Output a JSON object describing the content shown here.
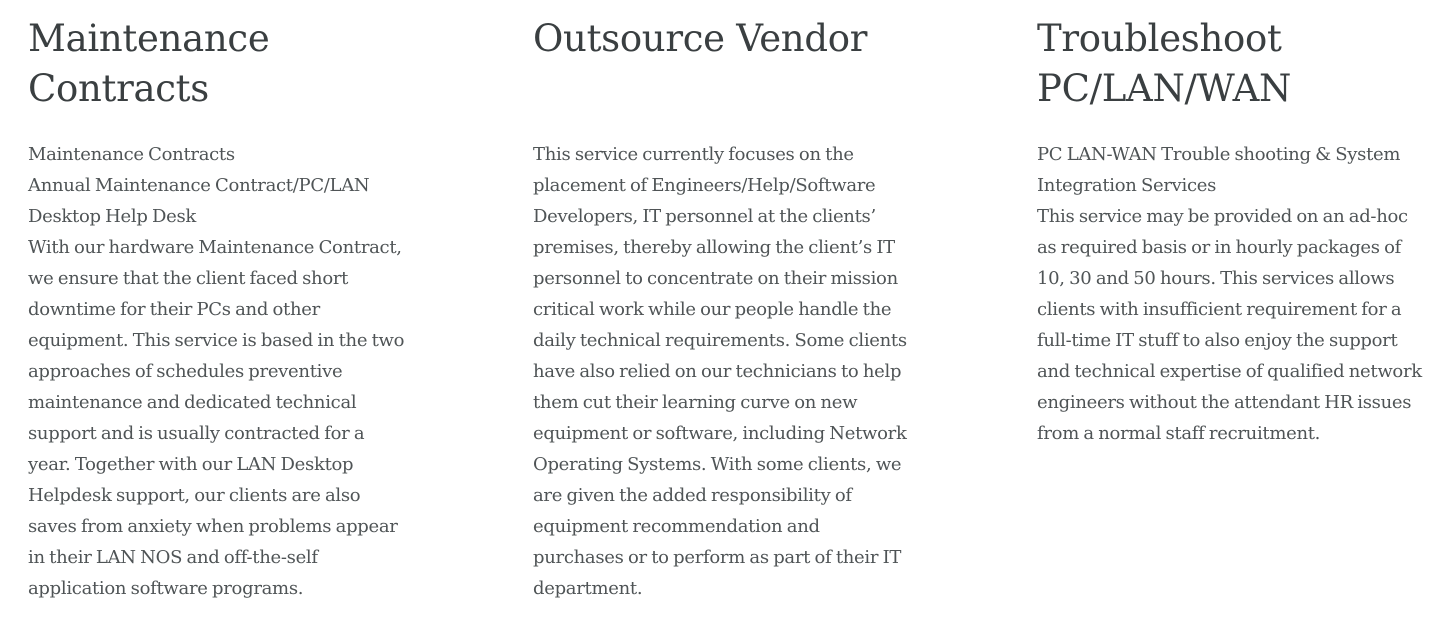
{
  "services": [
    {
      "title": "Maintenance Contracts",
      "paragraphs": [
        "Maintenance Contracts",
        "Annual Maintenance Contract/PC/LAN Desktop Help Desk",
        "With our hardware Maintenance Contract, we ensure that the client faced short downtime for their PCs and other equipment. This service is based in the two approaches of schedules preventive maintenance and dedicated technical support and is usually contracted for a year. Together with our LAN Desktop Helpdesk support, our clients are also saves from anxiety when problems appear in their LAN NOS and off-the-self application software programs."
      ]
    },
    {
      "title": "Outsource Vendor",
      "paragraphs": [
        "This service currently focuses on the placement of Engineers/Help/Software Developers, IT personnel at the clients’ premises, thereby allowing the client’s IT personnel to concentrate on their mission critical work while our people handle the daily technical requirements. Some clients have also relied on our technicians to help them cut their learning curve on new equipment or software, including Network Operating Systems. With some clients, we are given the added responsibility of equipment recommendation and purchases or to perform as part of their IT department."
      ]
    },
    {
      "title": "Troubleshoot PC/LAN/WAN",
      "paragraphs": [
        "PC LAN-WAN Trouble shooting & System Integration Services",
        "This service may be provided on an ad-hoc as required basis or in hourly packages of 10, 30 and 50 hours. This services allows clients with insufficient requirement for a full-time IT stuff to also enjoy the support and technical expertise of qualified network engineers without the attendant HR issues from a normal staff recruitment."
      ]
    }
  ]
}
